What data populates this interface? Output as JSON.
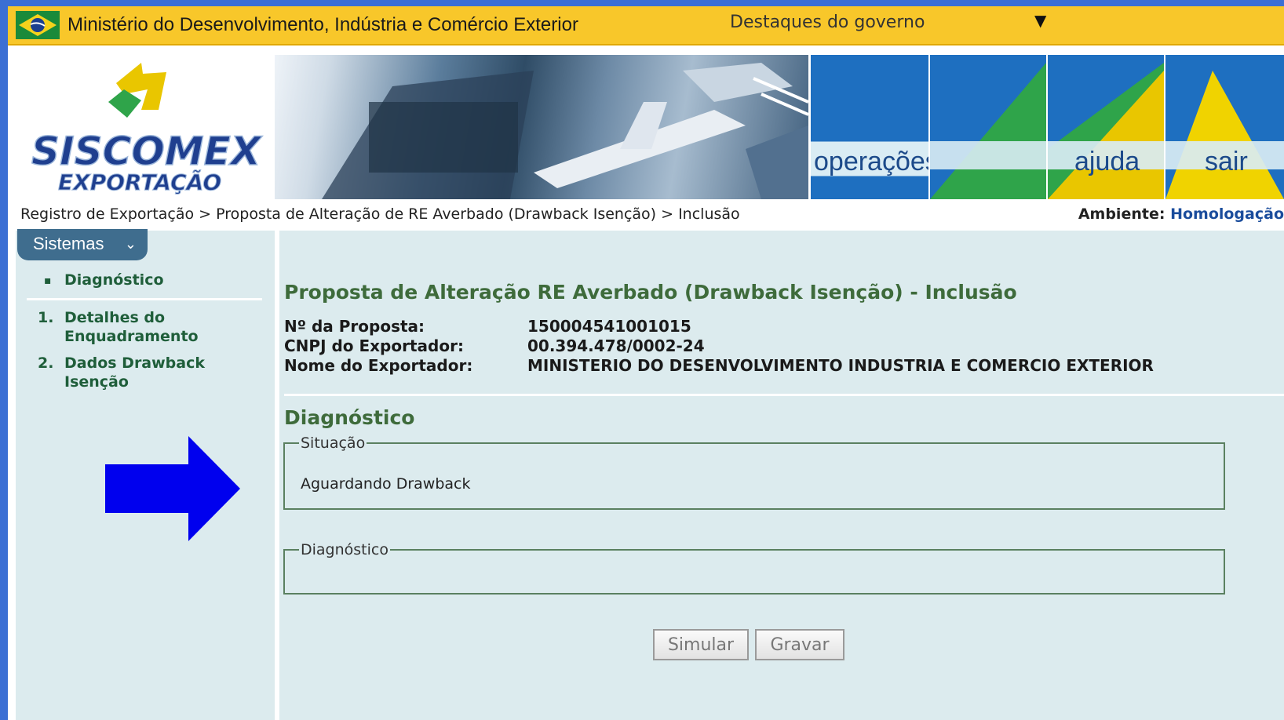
{
  "gov_bar": {
    "ministry": "Ministério do Desenvolvimento, Indústria e Comércio Exterior",
    "destaques": "Destaques do governo",
    "destaques_arrow": "▼"
  },
  "header": {
    "logo_title": "SISCOMEX",
    "logo_subtitle": "EXPORTAÇÃO",
    "menu": [
      "operações",
      "ajuda",
      "sair"
    ]
  },
  "breadcrumb": "Registro de Exportação > Proposta de Alteração de RE Averbado (Drawback Isenção) > Inclusão",
  "ambiente": {
    "label": "Ambiente:",
    "value": "Homologação"
  },
  "sidebar": {
    "sistemas": "Sistemas",
    "items": [
      {
        "marker": "▪",
        "label": "Diagnóstico"
      },
      {
        "marker": "1.",
        "line1": "Detalhes do",
        "line2": "Enquadramento"
      },
      {
        "marker": "2.",
        "line1": "Dados Drawback",
        "line2": "Isenção"
      }
    ]
  },
  "main": {
    "title": "Proposta de Alteração RE Averbado (Drawback Isenção) - Inclusão",
    "info": [
      {
        "label": "Nº da Proposta:",
        "value": "150004541001015"
      },
      {
        "label": "CNPJ do Exportador:",
        "value": "00.394.478/0002-24"
      },
      {
        "label": "Nome do Exportador:",
        "value": "MINISTERIO DO DESENVOLVIMENTO INDUSTRIA E COMERCIO EXTERIOR"
      }
    ],
    "diagnostico_heading": "Diagnóstico",
    "situacao_legend": "Situação",
    "situacao_value": "Aguardando Drawback",
    "diagnostico_legend": "Diagnóstico",
    "buttons": {
      "simular": "Simular",
      "gravar": "Gravar"
    }
  },
  "colors": {
    "gov_bar": "#f8c72a",
    "panel": "#dcebee",
    "heading": "#3e6b3b",
    "annotation_arrow": "#0000ee"
  }
}
